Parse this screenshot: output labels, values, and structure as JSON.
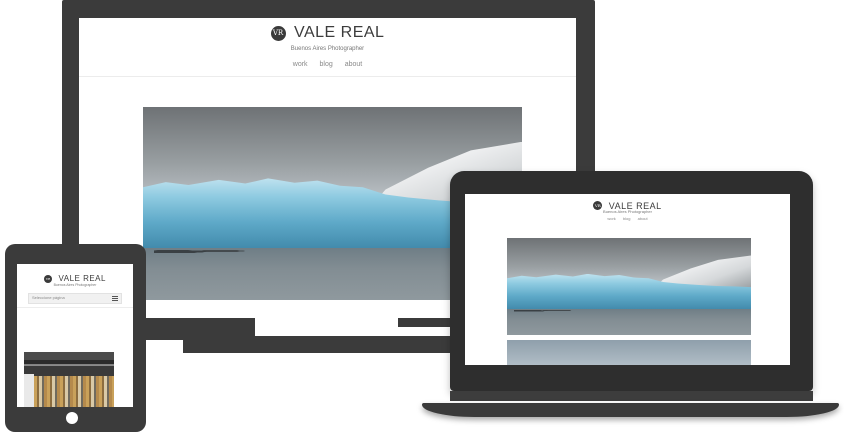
{
  "site": {
    "monogram": "VR",
    "name": "VALE REAL",
    "tagline": "Buenos Aires Photographer",
    "nav": [
      "work",
      "blog",
      "about"
    ]
  },
  "tablet": {
    "dropdown_placeholder": "Seleccione página"
  },
  "colors": {
    "device_frame": "#3b3b3b",
    "laptop_lid": "#2e2e2e",
    "page_background": "#ffffff",
    "nav_text": "#8a8a8a"
  },
  "icons": {
    "menu": "hamburger-icon",
    "monogram": "logo-monogram"
  }
}
